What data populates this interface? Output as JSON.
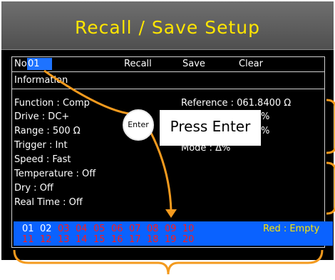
{
  "title": "Recall / Save Setup",
  "top_row": {
    "no_label": "No.",
    "no_value": "01",
    "recall_label": "Recall",
    "save_label": "Save",
    "clear_label": "Clear"
  },
  "information_label": "Information",
  "info_left": [
    "Function : Comp",
    "Drive : DC+",
    "Range : 500 Ω",
    "Trigger : Int",
    "Speed : Fast",
    "Temperature : Off",
    "Dry : Off",
    "Real Time : Off"
  ],
  "info_right": {
    "reference": "Reference : 061.8400 Ω",
    "pct_1": "%",
    "pct_2": "%",
    "mode": "Mode : Δ%"
  },
  "slots": {
    "row1": [
      "01",
      "02",
      "03",
      "04",
      "05",
      "06",
      "07",
      "08",
      "09",
      "10"
    ],
    "row2": [
      "11",
      "12",
      "13",
      "14",
      "15",
      "16",
      "17",
      "18",
      "19",
      "20"
    ],
    "occupied": [
      "01",
      "02"
    ],
    "legend": "Red : Empty"
  },
  "annotations": {
    "enter_circle": "Enter",
    "press_enter": "Press Enter"
  },
  "colors": {
    "title_text": "#ffe600",
    "slot_bar": "#0a62ff",
    "empty_slot": "#ff1a1a",
    "annotation": "#f39a1e"
  }
}
